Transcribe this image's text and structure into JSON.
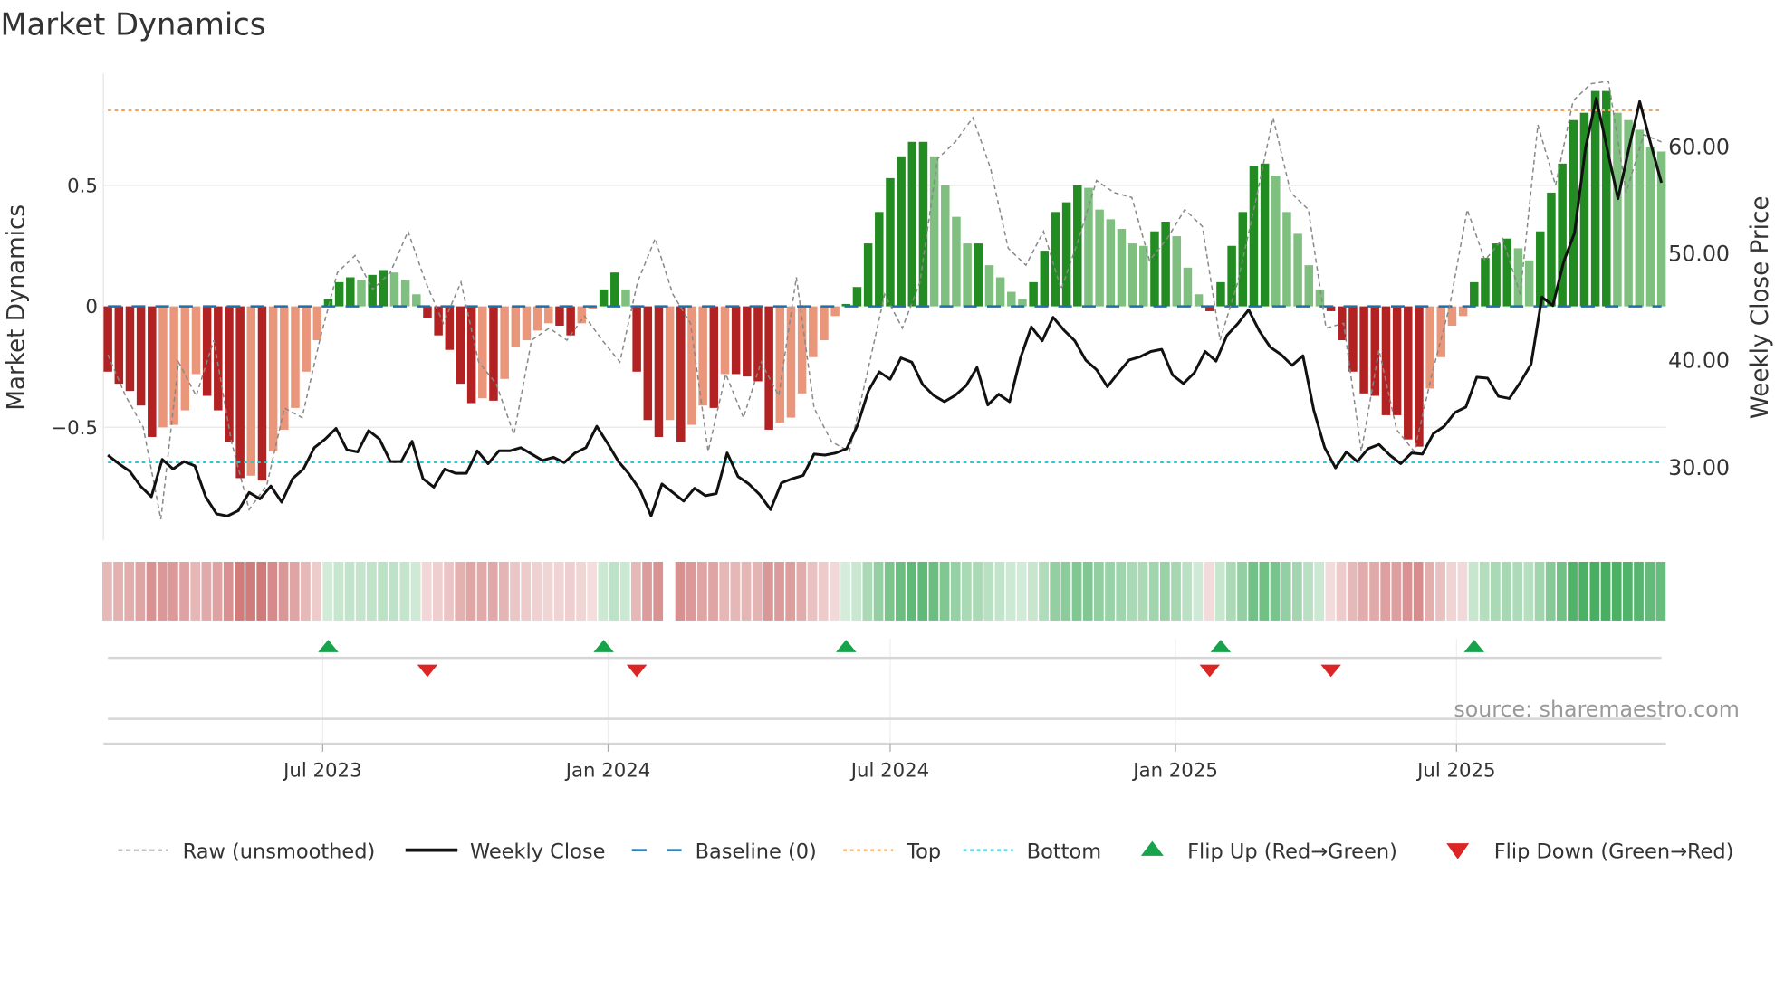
{
  "chart_data": {
    "type": "bar",
    "title": "Market Dynamics",
    "ylabel": "Market Dynamics",
    "ylabel_right": "Weekly Close Price",
    "ylim": [
      -0.97,
      0.97
    ],
    "ylim_right": [
      22,
      67
    ],
    "y_ticks": [
      {
        "value": 0.5,
        "label": "0.5"
      },
      {
        "value": 0,
        "label": "0"
      },
      {
        "value": -0.5,
        "label": "−0.5"
      }
    ],
    "y_ticks_right": [
      {
        "value": 60,
        "label": "60.00"
      },
      {
        "value": 50,
        "label": "50.00"
      },
      {
        "value": 40,
        "label": "40.00"
      },
      {
        "value": 30,
        "label": "30.00"
      }
    ],
    "x_ticks": [
      {
        "week": 19.5,
        "label": "Jul 2023"
      },
      {
        "week": 45.4,
        "label": "Jan 2024"
      },
      {
        "week": 71.0,
        "label": "Jul 2024"
      },
      {
        "week": 96.9,
        "label": "Jan 2025"
      },
      {
        "week": 122.4,
        "label": "Jul 2025"
      }
    ],
    "top_threshold": 0.81,
    "bottom_threshold": -0.645,
    "baseline": 0,
    "dynamics": [
      -0.27,
      -0.32,
      -0.35,
      -0.41,
      -0.54,
      -0.5,
      -0.49,
      -0.43,
      -0.28,
      -0.37,
      -0.43,
      -0.56,
      -0.71,
      -0.7,
      -0.72,
      -0.6,
      -0.51,
      -0.42,
      -0.27,
      -0.14,
      0.03,
      0.1,
      0.12,
      0.11,
      0.13,
      0.15,
      0.14,
      0.11,
      0.05,
      -0.05,
      -0.12,
      -0.18,
      -0.32,
      -0.4,
      -0.38,
      -0.39,
      -0.3,
      -0.17,
      -0.14,
      -0.1,
      -0.07,
      -0.08,
      -0.12,
      -0.07,
      -0.01,
      0.07,
      0.14,
      0.07,
      -0.27,
      -0.47,
      -0.54,
      -0.47,
      -0.56,
      -0.49,
      -0.41,
      -0.42,
      -0.28,
      -0.28,
      -0.29,
      -0.31,
      -0.51,
      -0.48,
      -0.46,
      -0.36,
      -0.21,
      -0.14,
      -0.04,
      0.01,
      0.08,
      0.26,
      0.39,
      0.53,
      0.62,
      0.68,
      0.68,
      0.62,
      0.5,
      0.37,
      0.26,
      0.26,
      0.17,
      0.12,
      0.06,
      0.03,
      0.1,
      0.23,
      0.39,
      0.43,
      0.5,
      0.49,
      0.4,
      0.36,
      0.32,
      0.26,
      0.25,
      0.31,
      0.35,
      0.29,
      0.16,
      0.05,
      -0.02,
      0.1,
      0.25,
      0.39,
      0.58,
      0.59,
      0.54,
      0.39,
      0.3,
      0.17,
      0.07,
      -0.02,
      -0.14,
      -0.27,
      -0.36,
      -0.37,
      -0.45,
      -0.45,
      -0.55,
      -0.58,
      -0.34,
      -0.21,
      -0.08,
      -0.04,
      0.1,
      0.2,
      0.26,
      0.28,
      0.24,
      0.19,
      0.31,
      0.47,
      0.59,
      0.77,
      0.8,
      0.89,
      0.89,
      0.8,
      0.77,
      0.73,
      0.66,
      0.64
    ],
    "raw": [
      -0.2,
      -0.37,
      -0.5,
      -0.88,
      -0.23,
      -0.37,
      -0.14,
      -0.56,
      -0.84,
      -0.74,
      -0.42,
      -0.46,
      -0.14,
      0.14,
      0.21,
      0.07,
      0.14,
      0.31,
      0.1,
      -0.07,
      0.1,
      -0.23,
      -0.32,
      -0.53,
      -0.14,
      -0.09,
      -0.14,
      -0.04,
      -0.14,
      -0.23,
      0.1,
      0.28,
      0.05,
      -0.07,
      -0.6,
      -0.28,
      -0.46,
      -0.23,
      -0.37,
      0.12,
      -0.42,
      -0.56,
      -0.6,
      -0.28,
      0.05,
      -0.09,
      0.1,
      0.61,
      0.68,
      0.78,
      0.57,
      0.24,
      0.17,
      0.31,
      0.07,
      0.28,
      0.52,
      0.47,
      0.45,
      0.19,
      0.28,
      0.4,
      0.33,
      -0.14,
      0.1,
      0.43,
      0.78,
      0.47,
      0.4,
      -0.09,
      -0.07,
      -0.6,
      -0.18,
      -0.51,
      -0.6,
      -0.28,
      0.0,
      0.4,
      0.19,
      0.28,
      0.05,
      0.75,
      0.5,
      0.85,
      0.92,
      0.93,
      0.47,
      0.71,
      0.68
    ],
    "weekly_close": [
      31.1,
      30.3,
      29.6,
      28.2,
      27.2,
      30.7,
      29.8,
      30.5,
      30.1,
      27.2,
      25.6,
      25.4,
      25.9,
      27.6,
      27.0,
      28.2,
      26.7,
      28.9,
      29.8,
      31.8,
      32.6,
      33.6,
      31.6,
      31.4,
      33.4,
      32.6,
      30.5,
      30.5,
      32.4,
      28.9,
      28.1,
      29.8,
      29.4,
      29.4,
      31.5,
      30.3,
      31.5,
      31.5,
      31.8,
      31.2,
      30.6,
      30.9,
      30.4,
      31.3,
      31.8,
      33.8,
      32.2,
      30.5,
      29.3,
      27.8,
      25.4,
      28.4,
      27.6,
      26.8,
      28.0,
      27.3,
      27.5,
      31.3,
      29.1,
      28.4,
      27.4,
      26.0,
      28.5,
      28.9,
      29.2,
      31.2,
      31.1,
      31.3,
      31.7,
      33.9,
      37.1,
      38.9,
      38.2,
      40.2,
      39.8,
      37.7,
      36.7,
      36.1,
      36.7,
      37.6,
      39.3,
      35.8,
      36.8,
      36.1,
      40.2,
      43.1,
      41.8,
      44.0,
      42.8,
      41.8,
      40.0,
      39.1,
      37.5,
      38.8,
      40.0,
      40.3,
      40.8,
      41.0,
      38.6,
      37.8,
      38.8,
      40.8,
      39.9,
      42.3,
      43.4,
      44.7,
      42.7,
      41.2,
      40.5,
      39.5,
      40.4,
      35.3,
      31.8,
      29.9,
      31.4,
      30.5,
      31.7,
      32.1,
      31.1,
      30.3,
      31.3,
      31.2,
      33.1,
      33.8,
      35.1,
      35.6,
      38.4,
      38.3,
      36.6,
      36.4,
      37.9,
      39.6,
      45.9,
      45.1,
      49.2,
      51.9,
      59.8,
      64.5,
      59.8,
      55.1,
      59.8,
      64.2,
      60.3,
      56.6
    ],
    "flip_up_weeks": [
      20,
      45,
      67,
      101,
      124
    ],
    "flip_down_weeks": [
      29,
      48,
      100,
      111
    ],
    "strip_missing_week": 51,
    "legend": [
      {
        "label": "Raw (unsmoothed)",
        "kind": "raw"
      },
      {
        "label": "Weekly Close",
        "kind": "close"
      },
      {
        "label": "Baseline (0)",
        "kind": "baseline"
      },
      {
        "label": "Top",
        "kind": "top"
      },
      {
        "label": "Bottom",
        "kind": "bottom"
      },
      {
        "label": "Flip Up (Red→Green)",
        "kind": "up"
      },
      {
        "label": "Flip Down (Green→Red)",
        "kind": "down"
      }
    ],
    "legend_position": "bottom",
    "source": "source: sharemaestro.com",
    "colors": {
      "strong_pos": "#228b22",
      "weak_pos": "#7fbf7f",
      "strong_neg": "#b22222",
      "weak_neg": "#e9967a",
      "raw": "#888888",
      "close": "#111111",
      "baseline": "#1f6fa8",
      "top": "#f0a460",
      "bottom": "#2ec7d6",
      "flip_up": "#16a34a",
      "flip_down": "#dc2626"
    }
  }
}
